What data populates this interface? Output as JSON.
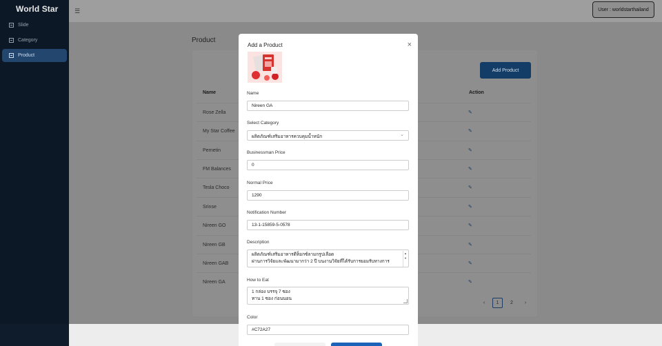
{
  "brand": "World Star",
  "sidebar": {
    "items": [
      {
        "label": "Slide"
      },
      {
        "label": "Category"
      },
      {
        "label": "Product"
      }
    ]
  },
  "topbar": {
    "menu_icon": "hamburger-icon",
    "user": "User : worldstarthailand"
  },
  "page": {
    "title": "Product",
    "add_button": "Add Product"
  },
  "table": {
    "columns": [
      "Name",
      "Action"
    ],
    "rows": [
      "Rose Zella",
      "My Star Coffee",
      "Pernetin",
      "FM Balances",
      "Tesla Choco",
      "Srinse",
      "Nireen GO",
      "Nireen GB",
      "Nireen GAB",
      "Nireen GA"
    ]
  },
  "pagination": {
    "prev": "‹",
    "pages": [
      "1",
      "2"
    ],
    "next": "›",
    "current": "1"
  },
  "modal": {
    "title": "Add a Product",
    "close": "×",
    "fields": {
      "name": {
        "label": "Name",
        "value": "Nireen GA"
      },
      "category": {
        "label": "Select Category",
        "value": "ผลิตภัณฑ์เสริมอาหารควบคุมน้ำหนัก"
      },
      "businessman_price": {
        "label": "Businessman Price",
        "value": "0"
      },
      "normal_price": {
        "label": "Normal Price",
        "value": "1290"
      },
      "notification_number": {
        "label": "Notification Number",
        "value": "13-1-15859-5-0578"
      },
      "description": {
        "label": "Description",
        "line1": "ผลิตภัณฑ์เสริมอาหารดีท็อกซ์ลามกรูปเลือด",
        "line2": "ผ่านการวิจัยและพัฒนามากว่า 2 ปี บนงานวิจัยที่ได้รับการยอมรับทางการ"
      },
      "how_to_eat": {
        "label": "How to Eat",
        "line1": "1 กล่อง บรรจุ 7 ซอง",
        "line2": "ทาน 1 ซอง ก่อนนอน"
      },
      "color": {
        "label": "Color",
        "value": "#C72A27"
      }
    }
  },
  "colors": {
    "sidebar_bg": "#0c1826",
    "active_item": "#22466e",
    "primary_button": "#133d66",
    "product_color": "#C72A27"
  }
}
